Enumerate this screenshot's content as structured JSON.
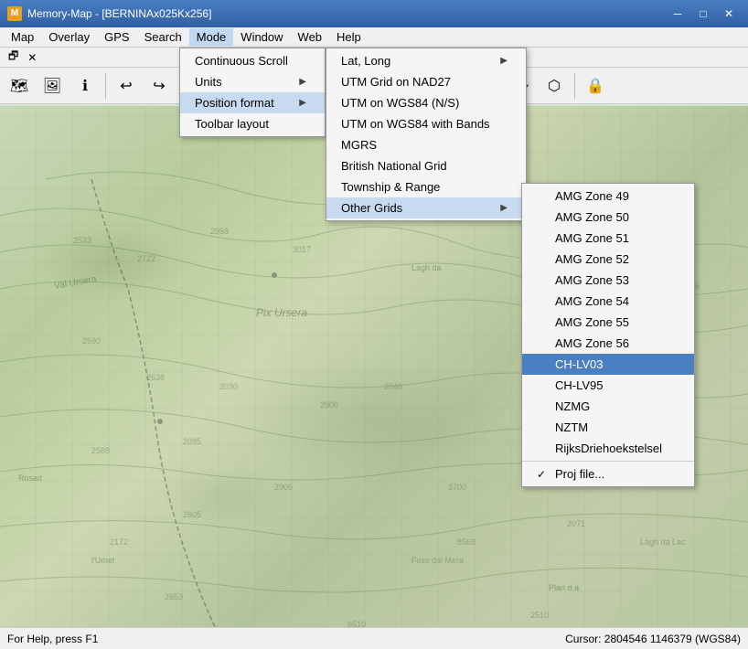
{
  "titlebar": {
    "title": "Memory-Map - [BERNINAx025Kx256]",
    "icon_label": "M",
    "minimize_label": "─",
    "maximize_label": "□",
    "close_label": "✕"
  },
  "menubar": {
    "items": [
      {
        "label": "Map",
        "id": "map"
      },
      {
        "label": "Overlay",
        "id": "overlay"
      },
      {
        "label": "GPS",
        "id": "gps"
      },
      {
        "label": "Search",
        "id": "search"
      },
      {
        "label": "Mode",
        "id": "mode",
        "active": true
      },
      {
        "label": "Window",
        "id": "window"
      },
      {
        "label": "Web",
        "id": "web"
      },
      {
        "label": "Help",
        "id": "help"
      }
    ]
  },
  "toolbar2": {
    "items": []
  },
  "mode_menu": {
    "items": [
      {
        "label": "Continuous Scroll",
        "has_arrow": false,
        "id": "continuous-scroll"
      },
      {
        "label": "Units",
        "has_arrow": true,
        "id": "units"
      },
      {
        "label": "Position format",
        "has_arrow": true,
        "id": "position-format",
        "active": true
      },
      {
        "label": "Toolbar layout",
        "has_arrow": false,
        "id": "toolbar-layout"
      }
    ]
  },
  "pos_format_menu": {
    "items": [
      {
        "label": "Lat, Long",
        "has_arrow": true,
        "id": "lat-long"
      },
      {
        "label": "UTM Grid on NAD27",
        "has_arrow": false,
        "id": "utm-nad27"
      },
      {
        "label": "UTM on WGS84 (N/S)",
        "has_arrow": false,
        "id": "utm-wgs84-ns"
      },
      {
        "label": "UTM on WGS84 with Bands",
        "has_arrow": false,
        "id": "utm-wgs84-bands"
      },
      {
        "label": "MGRS",
        "has_arrow": false,
        "id": "mgrs"
      },
      {
        "label": "British National Grid",
        "has_arrow": false,
        "id": "british-national-grid"
      },
      {
        "label": "Township & Range",
        "has_arrow": false,
        "id": "township-range"
      },
      {
        "label": "Other Grids",
        "has_arrow": true,
        "id": "other-grids",
        "active": true
      }
    ]
  },
  "other_grids_menu": {
    "items": [
      {
        "label": "AMG Zone 49",
        "id": "amg49",
        "checked": false
      },
      {
        "label": "AMG Zone 50",
        "id": "amg50",
        "checked": false
      },
      {
        "label": "AMG Zone 51",
        "id": "amg51",
        "checked": false
      },
      {
        "label": "AMG Zone 52",
        "id": "amg52",
        "checked": false
      },
      {
        "label": "AMG Zone 53",
        "id": "amg53",
        "checked": false
      },
      {
        "label": "AMG Zone 54",
        "id": "amg54",
        "checked": false
      },
      {
        "label": "AMG Zone 55",
        "id": "amg55",
        "checked": false
      },
      {
        "label": "AMG Zone 56",
        "id": "amg56",
        "checked": false
      },
      {
        "label": "CH-LV03",
        "id": "chlv03",
        "checked": false,
        "highlighted": true
      },
      {
        "label": "CH-LV95",
        "id": "chlv95",
        "checked": false
      },
      {
        "label": "NZMG",
        "id": "nzmg",
        "checked": false
      },
      {
        "label": "NZTM",
        "id": "nztm",
        "checked": false
      },
      {
        "label": "RijksDriehoekstelsel",
        "id": "rijks",
        "checked": false
      },
      {
        "label": "Proj file...",
        "id": "projfile",
        "checked": true
      }
    ]
  },
  "statusbar": {
    "help_text": "For Help, press F1",
    "cursor_text": "Cursor: 2804546 1146379 (WGS84)"
  }
}
